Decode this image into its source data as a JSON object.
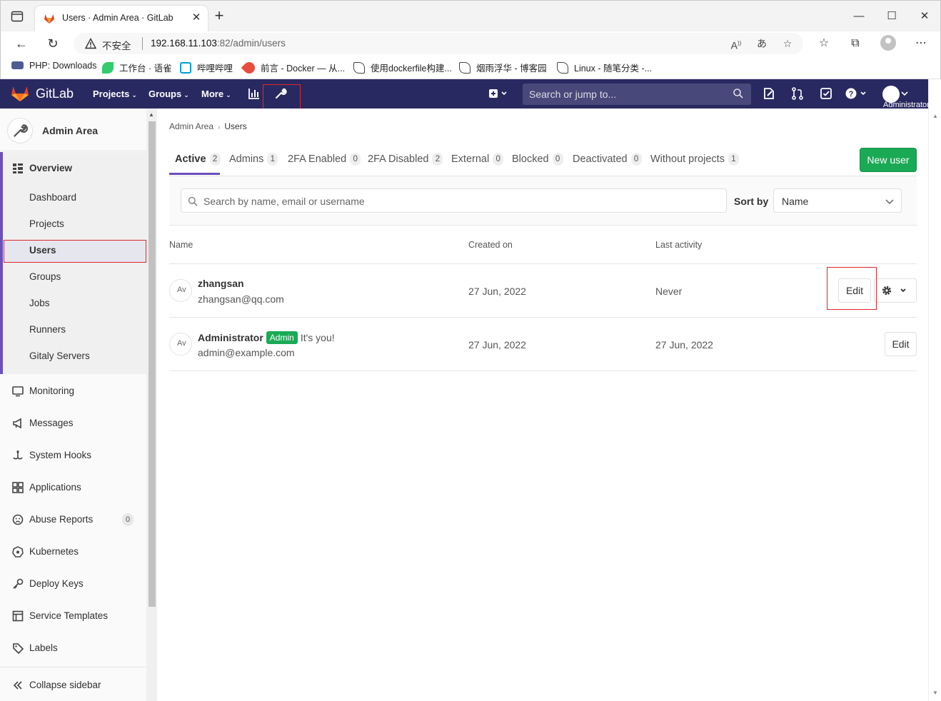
{
  "browser": {
    "tab_title": "Users · Admin Area · GitLab",
    "address": {
      "insecure_label": "不安全",
      "host": "192.168.11.103",
      "path": ":82/admin/users"
    },
    "bookmarks": [
      {
        "label": "PHP: Downloads",
        "icon": "php-icon",
        "color": "#4f5b93"
      },
      {
        "label": "工作台 · 语雀",
        "icon": "yuque-icon",
        "color": "#31cc6b"
      },
      {
        "label": "哔哩哔哩",
        "icon": "bilibili-icon",
        "color": "#00a1d6"
      },
      {
        "label": "前言 - Docker — 从...",
        "icon": "rocket-icon",
        "color": "#e84c3d"
      },
      {
        "label": "使用dockerfile构建...",
        "icon": "cnblogs-icon",
        "color": "#444444"
      },
      {
        "label": "烟雨浮华 - 博客园",
        "icon": "cnblogs-icon",
        "color": "#444444"
      },
      {
        "label": "Linux - 随笔分类 -...",
        "icon": "cnblogs-icon",
        "color": "#444444"
      }
    ]
  },
  "navbar": {
    "brand": "GitLab",
    "menus": [
      {
        "label": "Projects"
      },
      {
        "label": "Groups"
      },
      {
        "label": "More"
      }
    ],
    "search_placeholder": "Search or jump to...",
    "user_label": "Administrator",
    "color": "#292961"
  },
  "sidebar": {
    "title": "Admin Area",
    "overview": "Overview",
    "overview_items": [
      "Dashboard",
      "Projects",
      "Users",
      "Groups",
      "Jobs",
      "Runners",
      "Gitaly Servers"
    ],
    "items": [
      {
        "label": "Monitoring",
        "icon": "monitor-icon"
      },
      {
        "label": "Messages",
        "icon": "messages-icon"
      },
      {
        "label": "System Hooks",
        "icon": "hook-icon"
      },
      {
        "label": "Applications",
        "icon": "applications-icon"
      },
      {
        "label": "Abuse Reports",
        "icon": "abuse-icon",
        "badge": "0"
      },
      {
        "label": "Kubernetes",
        "icon": "kubernetes-icon"
      },
      {
        "label": "Deploy Keys",
        "icon": "key-icon"
      },
      {
        "label": "Service Templates",
        "icon": "template-icon"
      },
      {
        "label": "Labels",
        "icon": "label-icon"
      }
    ],
    "collapse": "Collapse sidebar"
  },
  "main": {
    "breadcrumb": [
      "Admin Area",
      "Users"
    ],
    "tabs": [
      {
        "label": "Active",
        "count": "2"
      },
      {
        "label": "Admins",
        "count": "1"
      },
      {
        "label": "2FA Enabled",
        "count": "0"
      },
      {
        "label": "2FA Disabled",
        "count": "2"
      },
      {
        "label": "External",
        "count": "0"
      },
      {
        "label": "Blocked",
        "count": "0"
      },
      {
        "label": "Deactivated",
        "count": "0"
      },
      {
        "label": "Without projects",
        "count": "1"
      }
    ],
    "new_user": "New user",
    "search_placeholder": "Search by name, email or username",
    "sort_label": "Sort by",
    "sort_value": "Name",
    "columns": [
      "Name",
      "Created on",
      "Last activity"
    ],
    "users": [
      {
        "avatar_alt": "Av",
        "name": "zhangsan",
        "email": "zhangsan@qq.com",
        "created": "27 Jun, 2022",
        "activity": "Never",
        "edit": "Edit"
      },
      {
        "avatar_alt": "Av",
        "name": "Administrator",
        "badge": "Admin",
        "note": "It's you!",
        "email": "admin@example.com",
        "created": "27 Jun, 2022",
        "activity": "27 Jun, 2022",
        "edit": "Edit"
      }
    ]
  },
  "colors": {
    "accent": "#6b4fbb",
    "success": "#1aaa55",
    "highlight": "#e0262b"
  }
}
